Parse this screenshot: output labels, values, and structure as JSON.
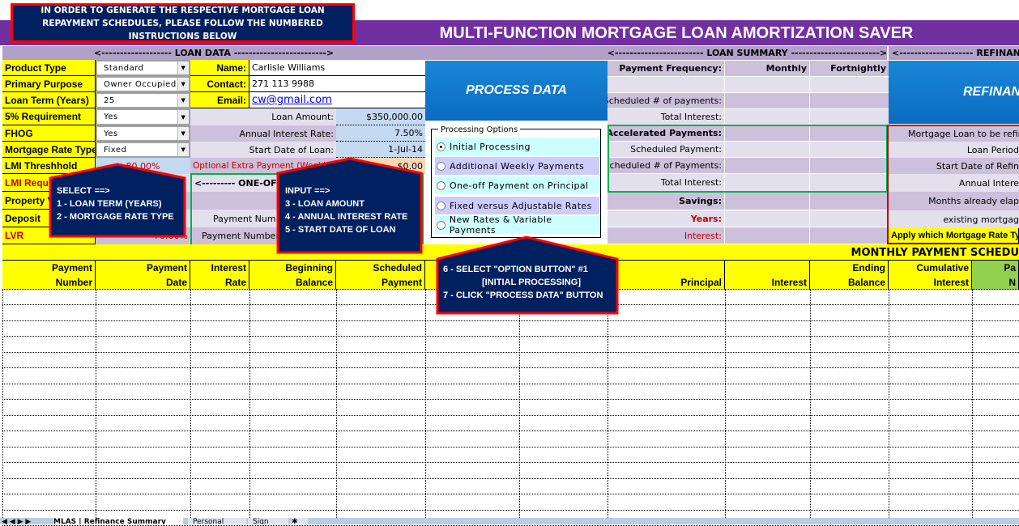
{
  "instruction_box": "IN ORDER TO GENERATE THE RESPECTIVE MORTGAGE LOAN REPAYMENT SCHEDULES, PLEASE FOLLOW THE NUMBERED INSTRUCTIONS BELOW",
  "title": "MULTI-FUNCTION MORTGAGE LOAN AMORTIZATION SAVER",
  "colors": {
    "title_band": "#7030a0",
    "yellow": "#ffff00",
    "button_blue": "#0b6cc0",
    "callout": "#002060",
    "callout_border": "#ff0000",
    "green_border": "#00b050"
  },
  "loan_data": {
    "header": "<------------------- LOAN DATA ------------------------->",
    "fields": [
      {
        "label": "Product Type",
        "value": "Standard"
      },
      {
        "label": "Primary Purpose",
        "value": "Owner Occupied"
      },
      {
        "label": "Loan Term (Years)",
        "value": "25"
      },
      {
        "label": "5% Requirement",
        "value": "Yes"
      },
      {
        "label": "FHOG",
        "value": "Yes"
      },
      {
        "label": "Mortgage Rate Type",
        "value": "Fixed"
      }
    ],
    "lmi_threshold_label": "LMI Threshhold",
    "lmi_threshold": "80.00%",
    "lmi_required_label": "LMI Required",
    "property_value_label": "Property Value",
    "deposit_label": "Deposit",
    "lvr_label": "LVR",
    "lvr": "70.00%",
    "name_label": "Name:",
    "name": "Carlisle Williams",
    "contact_label": "Contact:",
    "contact": "271 113 9988",
    "email_label": "Email:",
    "email": "cw@gmail.com",
    "loan_amount_label": "Loan Amount:",
    "loan_amount": "$350,000.00",
    "rate_label": "Annual Interest Rate:",
    "rate": "7.50%",
    "start_label": "Start Date of Loan:",
    "start": "1-Jul-14",
    "extra_label": "Optional Extra Payment (Weekly)",
    "extra": "$0.00",
    "oneoff_header": "<--------- ONE-OFF PAYMENT",
    "payment_number_1": "Payment Number",
    "payment_number_2": "Payment Number"
  },
  "process_button": "PROCESS DATA",
  "processing_options": {
    "legend": "Processing Options",
    "selected": 0,
    "items": [
      "Initial Processing",
      "Additional Weekly Payments",
      "One-off Payment on Principal",
      "Fixed versus Adjustable Rates",
      "New Rates & Variable Payments"
    ]
  },
  "loan_summary": {
    "header": "<------------------------ LOAN SUMMARY ------------------------>",
    "freq_label": "Payment Frequency:",
    "monthly": "Monthly",
    "fortnightly": "Fortnightly",
    "sched_payments": "Scheduled # of payments:",
    "total_interest": "Total Interest:",
    "accel": "Accelerated Payments:",
    "sched_payment": "Scheduled Payment:",
    "sched_payments2": "Scheduled # of Payments:",
    "total_interest2": "Total Interest:",
    "savings": "Savings:",
    "years": "Years:",
    "interest": "Interest:"
  },
  "refinancing": {
    "header": "<-------------------- REFINANCING",
    "button": "REFINANCE",
    "rows": [
      "Mortgage Loan to be refin",
      "Loan Period",
      "Start Date of Refin",
      "Annual Intere",
      "Months already elap",
      "existing mortgag"
    ],
    "apply": "Apply which Mortgage Rate Typ"
  },
  "schedule": {
    "title": "MONTHLY PAYMENT SCHEDU",
    "columns": [
      [
        "Payment",
        "Number"
      ],
      [
        "Payment",
        "Date"
      ],
      [
        "Interest",
        "Rate"
      ],
      [
        "Beginning",
        "Balance"
      ],
      [
        "Scheduled",
        "Payment"
      ],
      [
        "",
        ""
      ],
      [
        "",
        ""
      ],
      [
        "",
        "Principal"
      ],
      [
        "",
        "Interest"
      ],
      [
        "Ending",
        "Balance"
      ],
      [
        "Cumulative",
        "Interest"
      ],
      [
        "Pa",
        "N"
      ]
    ]
  },
  "callouts": {
    "select": [
      "SELECT ==>",
      "1 - LOAN TERM  (YEARS)",
      "2 - MORTGAGE  RATE  TYPE"
    ],
    "input": [
      "INPUT ==>",
      "3 - LOAN AMOUNT",
      "4 - ANNUAL INTEREST RATE",
      "5 - START  DATE  OF LOAN"
    ],
    "process": [
      "6 - SELECT \"OPTION BUTTON\" #1",
      "[INITIAL PROCESSING]",
      "7 - CLICK \"PROCESS  DATA\" BUTTON"
    ]
  },
  "sheet_tabs": [
    "MLAS | Refinance Summary",
    "Personal",
    "Sign"
  ]
}
